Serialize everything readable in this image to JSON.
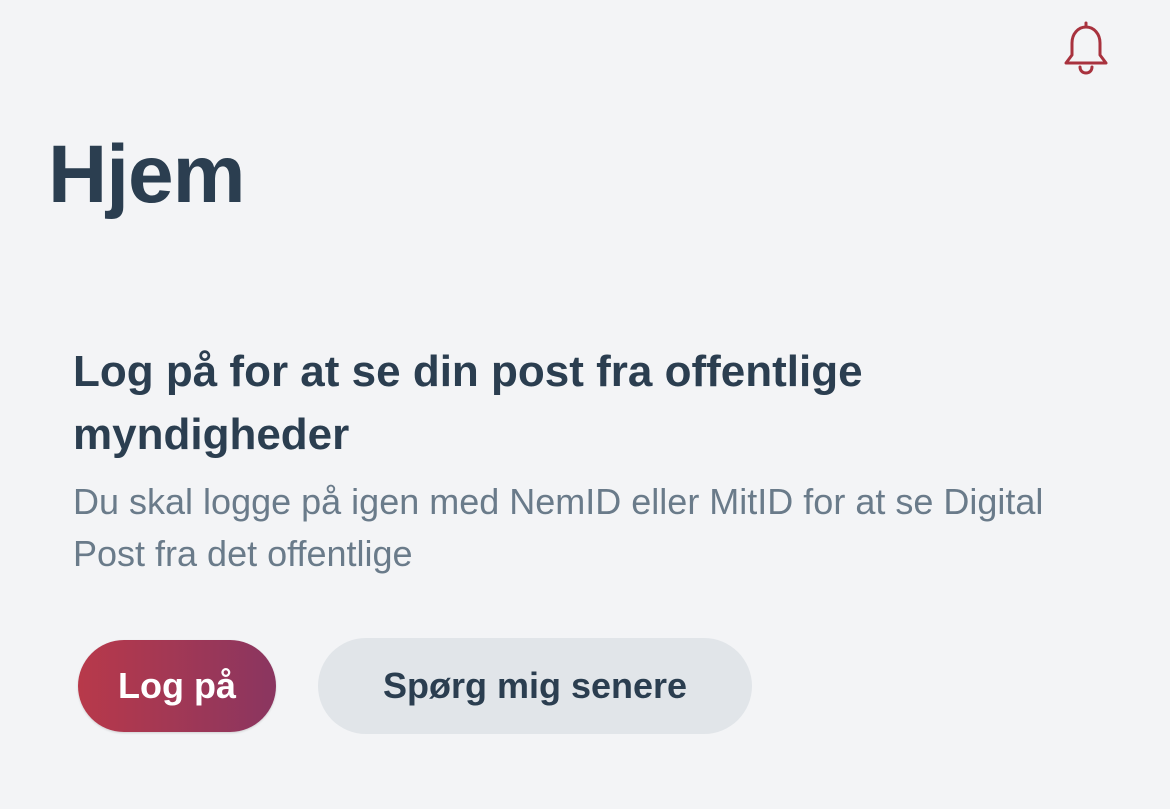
{
  "header": {
    "notification_icon": "bell-icon",
    "accent_color": "#a8323e"
  },
  "page": {
    "title": "Hjem"
  },
  "login_card": {
    "title": "Log på for at se din post fra offentlige myndigheder",
    "body": "Du skal logge på igen med NemID eller MitID for at se Digital Post fra det offentlige",
    "primary_button_label": "Log på",
    "secondary_button_label": "Spørg mig senere",
    "primary_gradient": [
      "#b8394a",
      "#8a3660"
    ],
    "secondary_bg": "#e1e5e9"
  }
}
